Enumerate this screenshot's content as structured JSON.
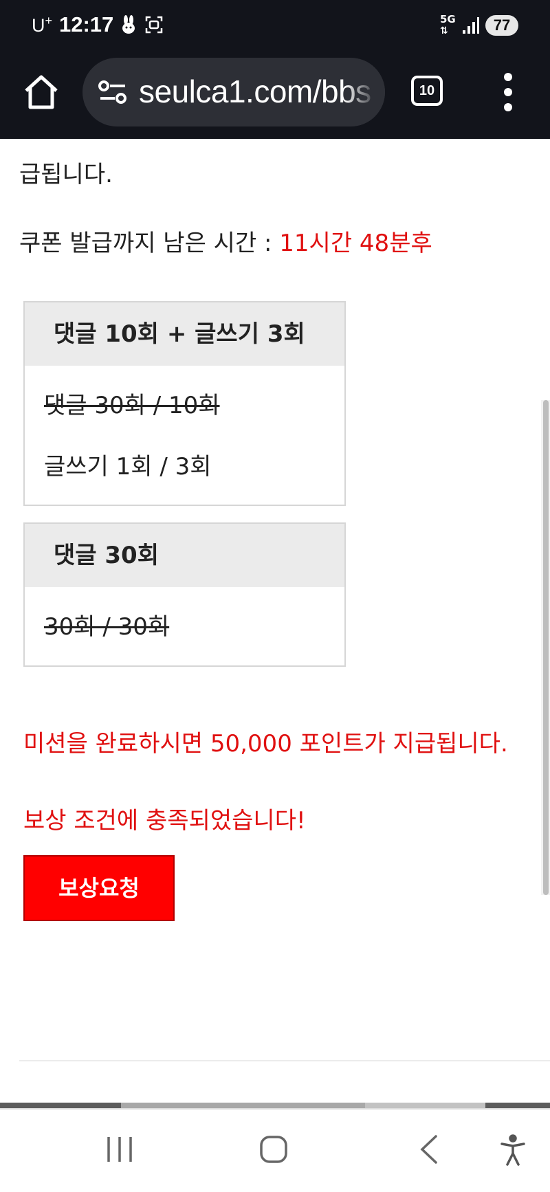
{
  "status_bar": {
    "carrier": "U",
    "carrier_sup": "+",
    "time": "12:17",
    "network": "5G",
    "battery": "77"
  },
  "browser": {
    "url": "seulca1.com/bbs",
    "tab_count": "10",
    "icons": [
      "home-icon",
      "site-settings-icon",
      "tabs-icon",
      "more-vert-icon"
    ]
  },
  "content": {
    "intro_tail": "급됩니다.",
    "coupon_label": "쿠폰 발급까지 남은 시간 : ",
    "coupon_time": "11시간 48분후",
    "missions": [
      {
        "title": "댓글 10회 + 글쓰기 3회",
        "items": [
          {
            "text": "댓글 30회 / 10회",
            "done": true
          },
          {
            "text": "글쓰기 1회 / 3회",
            "done": false
          }
        ]
      },
      {
        "title": "댓글 30회",
        "items": [
          {
            "text": "30회 / 30회",
            "done": true
          }
        ]
      }
    ],
    "reward_notice": "미션을 완료하시면 50,000 포인트가 지급됩니다.",
    "reward_status": "보상 조건에 충족되었습니다!",
    "reward_button": "보상요청"
  },
  "nav_bar": {
    "icons": [
      "recents-icon",
      "home-icon",
      "back-icon",
      "accessibility-icon"
    ]
  },
  "colors": {
    "accent_red": "#e01010",
    "button_red": "#ff0000",
    "chrome_dark": "#12141b"
  }
}
